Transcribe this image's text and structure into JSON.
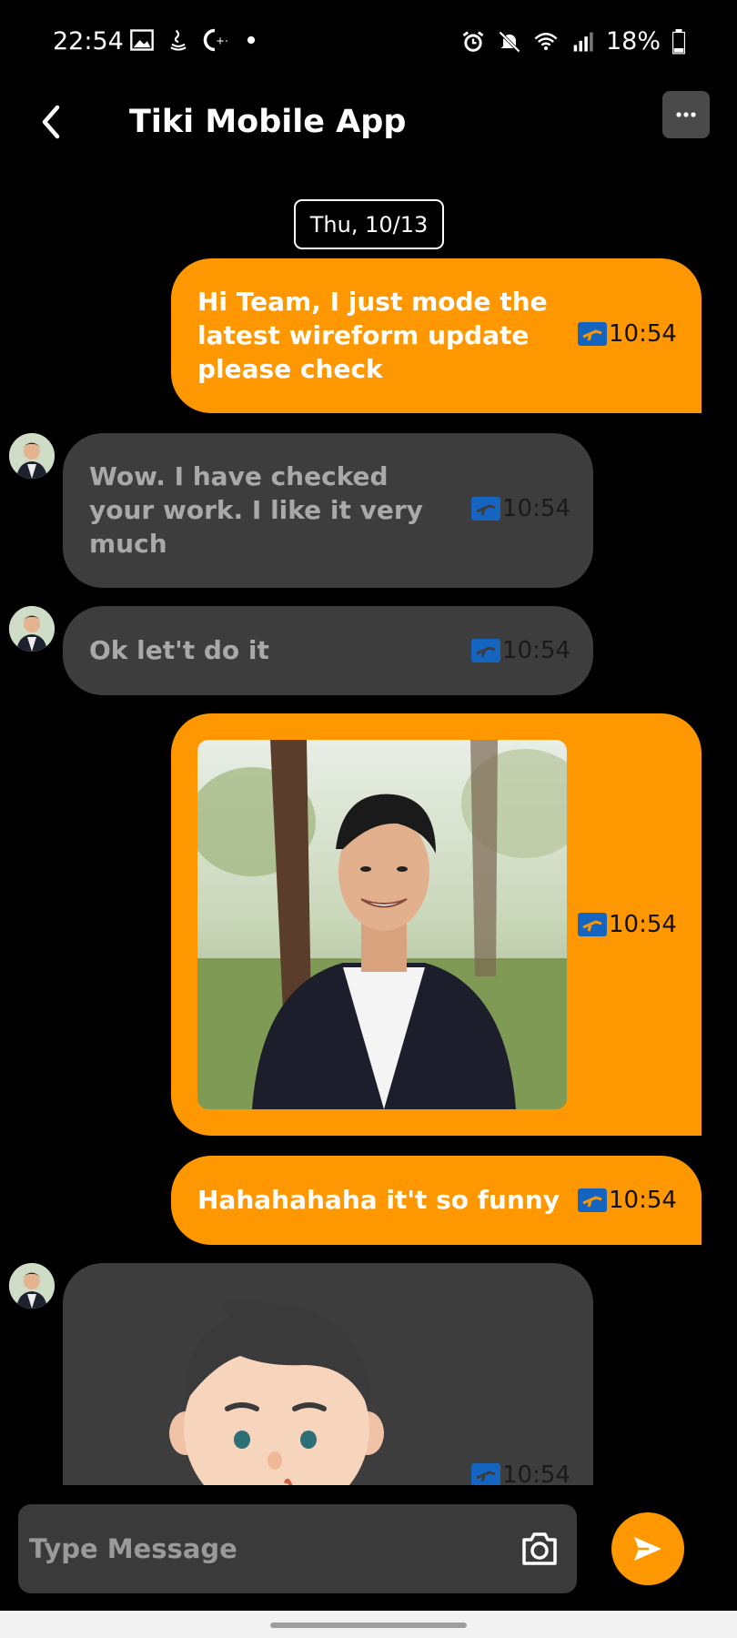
{
  "status_bar": {
    "time": "22:54",
    "battery": "18%",
    "left_icons": [
      "image-icon",
      "java-icon",
      "cpp-icon",
      "dot-icon"
    ],
    "right_icons": [
      "alarm-icon",
      "mute-icon",
      "wifi-icon",
      "signal-icon",
      "battery-icon"
    ]
  },
  "header": {
    "title": "Tiki Mobile App",
    "back_icon": "chevron-left-icon",
    "more_icon": "more-horizontal-icon"
  },
  "date_separator": "Thu, 10/13",
  "colors": {
    "accent": "#ff9800",
    "incoming_bubble": "#3d3d3d",
    "background": "#000000",
    "status_icon": "#1565c0"
  },
  "messages": [
    {
      "direction": "out",
      "type": "text",
      "lines": [
        "Hi Team, I just mode the",
        "latest wireform update",
        "please check"
      ],
      "time": "10:54"
    },
    {
      "direction": "in",
      "type": "text",
      "lines": [
        "Wow. I have checked",
        "your work. I like it very",
        "much"
      ],
      "time": "10:54"
    },
    {
      "direction": "in",
      "type": "text",
      "lines": [
        "Ok let't do it"
      ],
      "time": "10:54"
    },
    {
      "direction": "out",
      "type": "image",
      "time": "10:54"
    },
    {
      "direction": "out",
      "type": "text",
      "lines": [
        "Hahahahaha it't so funny"
      ],
      "time": "10:54"
    },
    {
      "direction": "in",
      "type": "sticker",
      "time": "10:54"
    }
  ],
  "composer": {
    "placeholder": "Type Message",
    "camera_icon": "camera-icon",
    "send_icon": "send-icon"
  }
}
